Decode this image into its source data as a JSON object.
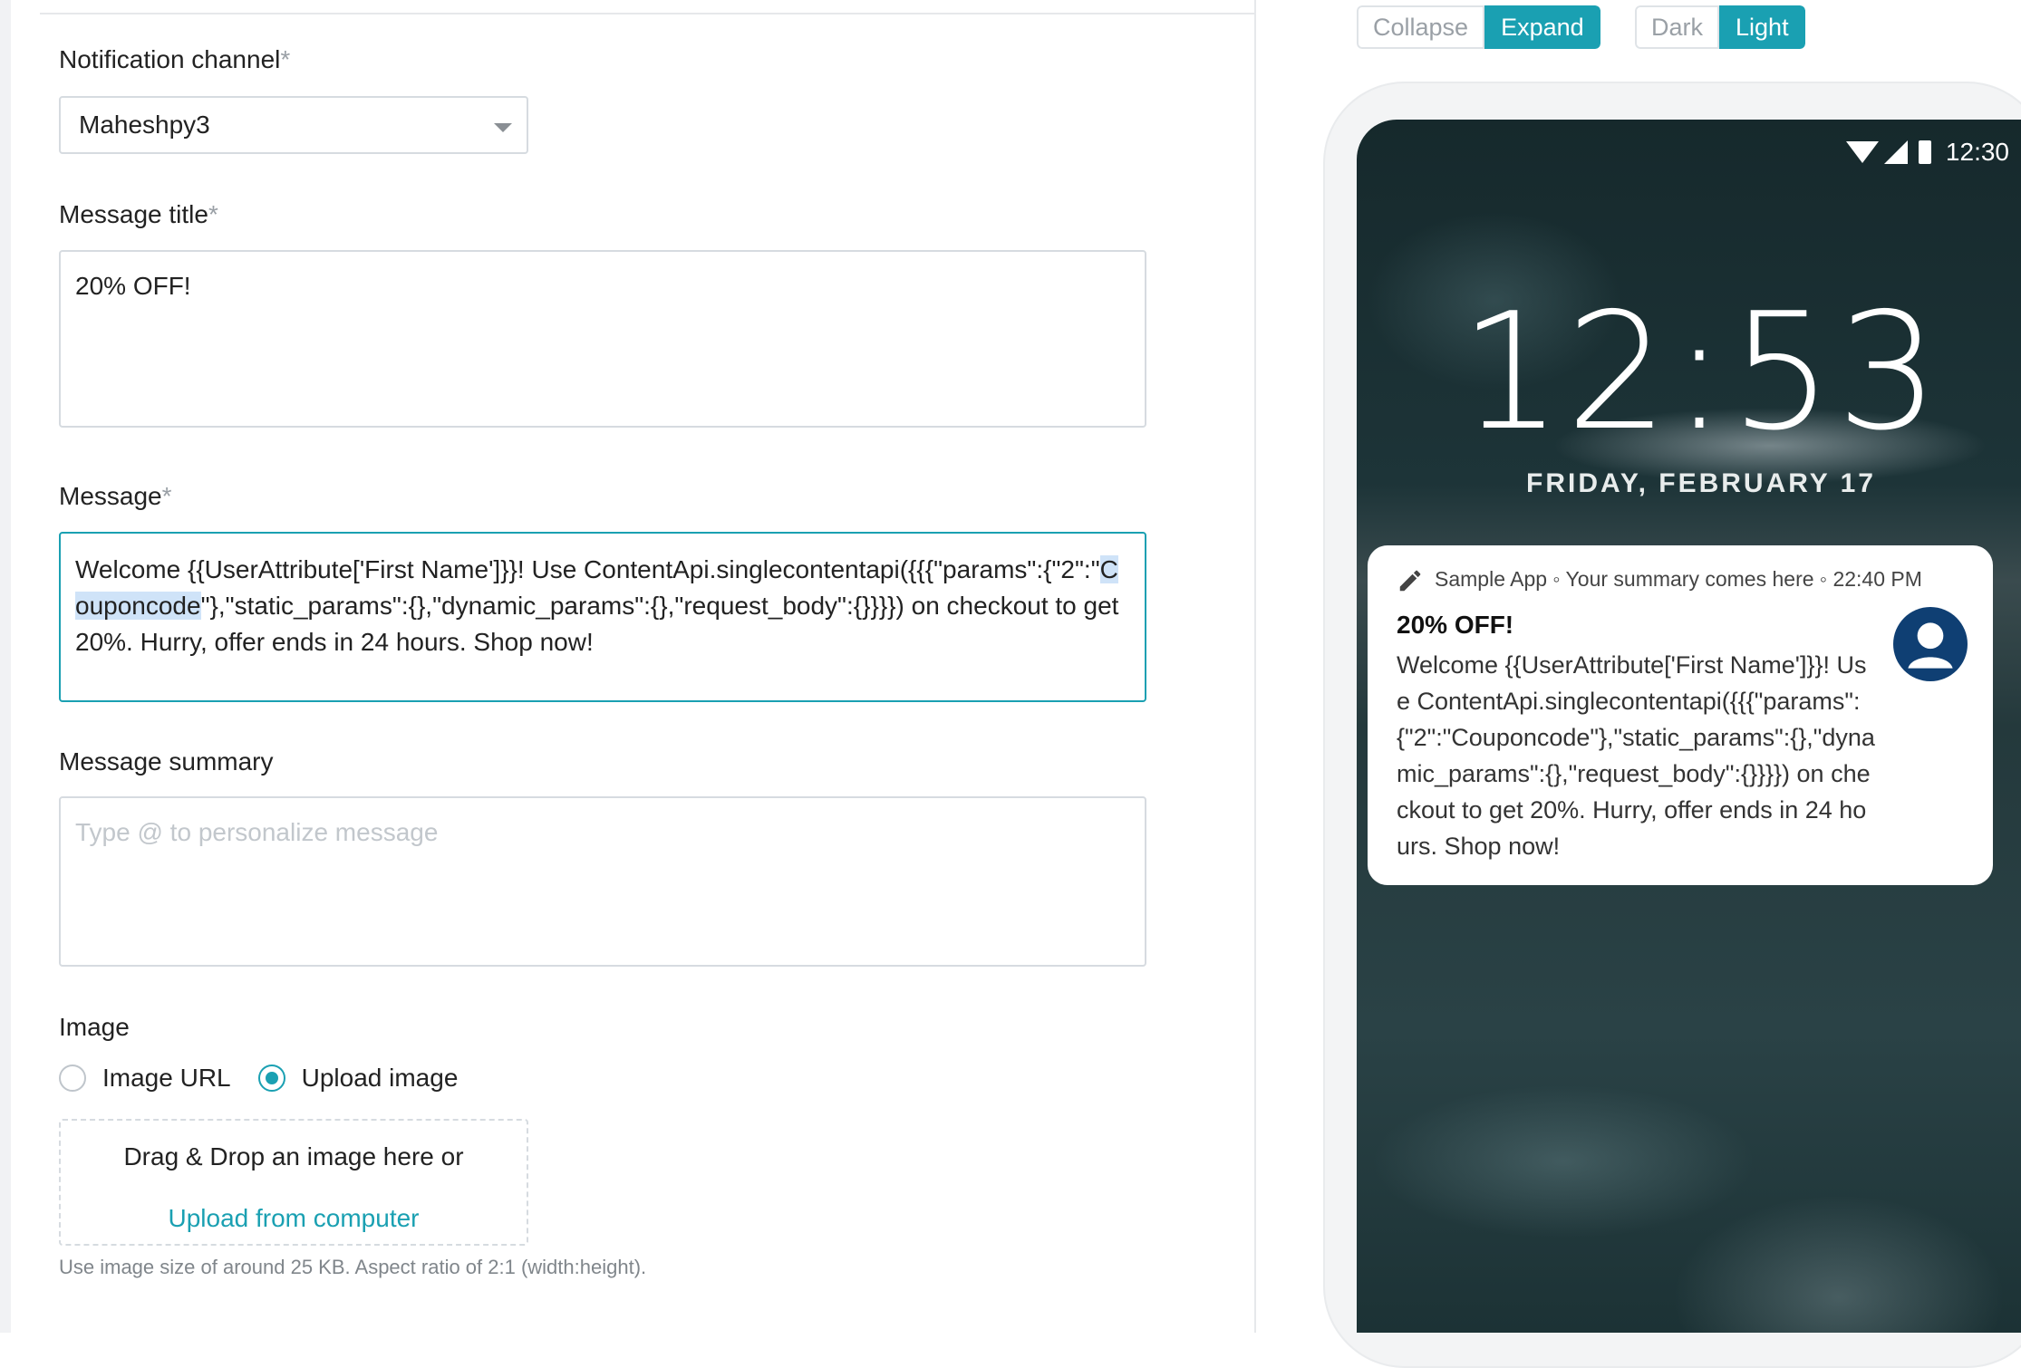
{
  "form": {
    "notification_channel": {
      "label": "Notification channel",
      "required": "*",
      "value": "Maheshpy3"
    },
    "message_title": {
      "label": "Message title",
      "required": "*",
      "value": "20% OFF!"
    },
    "message": {
      "label": "Message",
      "required": "*",
      "text_before": "Welcome {{UserAttribute['First Name']}}! Use ContentApi.singlecontentapi({{{\"params\":{\"2\":\"",
      "highlight": "Couponcode",
      "text_after": "\"},\"static_params\":{},\"dynamic_params\":{},\"request_body\":{}}}}) on checkout to get 20%. Hurry, offer ends in 24 hours. Shop now!"
    },
    "message_summary": {
      "label": "Message summary",
      "placeholder": "Type @ to personalize message"
    },
    "image": {
      "label": "Image",
      "options": [
        "Image URL",
        "Upload image"
      ],
      "selected": "Upload image",
      "dropzone_text": "Drag & Drop an image here or",
      "upload_link": "Upload from computer",
      "hint": "Use image size of around 25 KB. Aspect ratio of 2:1 (width:height)."
    }
  },
  "preview": {
    "size_toggle": [
      "Collapse",
      "Expand"
    ],
    "size_active": "Expand",
    "theme_toggle": [
      "Dark",
      "Light"
    ],
    "theme_active": "Light",
    "status_time": "12:30",
    "lock_time": "12:53",
    "lock_date": "FRIDAY, FEBRUARY 17",
    "notification": {
      "meta": "Sample App ◦ Your summary comes here ◦ 22:40 PM",
      "title": "20% OFF!",
      "body": "Welcome {{UserAttribute['First Name']}}! Use ContentApi.singlecontentapi({{{\"params\":{\"2\":\"Couponcode\"},\"static_params\":{},\"dynamic_params\":{},\"request_body\":{}}}}) on checkout to get 20%. Hurry, offer ends in 24 hours. Shop now!"
    }
  },
  "colors": {
    "accent": "#1aa0b2",
    "border": "#d6dbe0",
    "highlight": "#cfe3f8"
  },
  "icons": {
    "select_caret": "chevron-down-icon",
    "notif_app": "pencil-icon",
    "avatar": "user-avatar-icon",
    "wifi": "wifi-icon",
    "signal": "signal-icon",
    "battery": "battery-icon"
  }
}
